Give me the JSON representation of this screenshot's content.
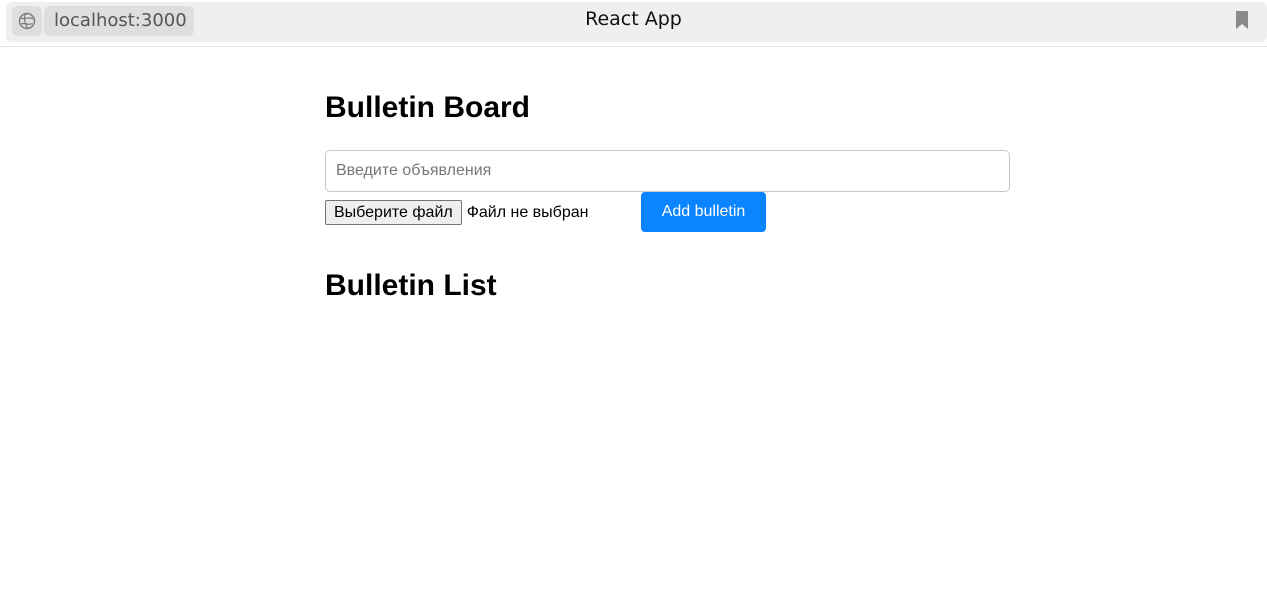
{
  "browser": {
    "url": "localhost:3000",
    "page_title": "React App",
    "icons": [
      "globe-icon",
      "bookmark-icon"
    ]
  },
  "main": {
    "title": "Bulletin Board",
    "input": {
      "placeholder": "Введите объявления",
      "value": ""
    },
    "file": {
      "button_label": "Выберите файл",
      "status": "Файл не выбран"
    },
    "add_button_label": "Add bulletin",
    "list_title": "Bulletin List",
    "bulletins": []
  },
  "colors": {
    "accent": "#0a84ff",
    "topbar": "#efefef"
  }
}
